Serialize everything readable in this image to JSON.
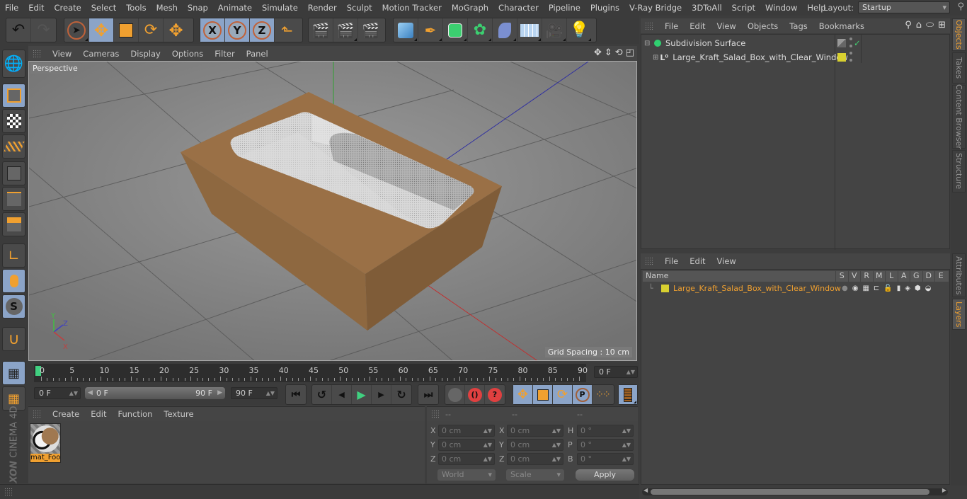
{
  "menubar": {
    "items": [
      "File",
      "Edit",
      "Create",
      "Select",
      "Tools",
      "Mesh",
      "Snap",
      "Animate",
      "Simulate",
      "Render",
      "Sculpt",
      "Motion Tracker",
      "MoGraph",
      "Character",
      "Pipeline",
      "Plugins",
      "V-Ray Bridge",
      "3DToAll",
      "Script",
      "Window",
      "Help"
    ],
    "layout_label": "Layout:",
    "layout_value": "Startup"
  },
  "toolbar": {
    "undo": "undo-icon",
    "redo": "redo-icon",
    "axis_x": "X",
    "axis_y": "Y",
    "axis_z": "Z"
  },
  "viewport": {
    "menu": [
      "View",
      "Cameras",
      "Display",
      "Options",
      "Filter",
      "Panel"
    ],
    "camera_label": "Perspective",
    "grid_spacing": "Grid Spacing : 10 cm",
    "axis_labels": {
      "x": "X",
      "y": "Y",
      "z": "Z"
    }
  },
  "timeline": {
    "ticks": [
      "0",
      "5",
      "10",
      "15",
      "20",
      "25",
      "30",
      "35",
      "40",
      "45",
      "50",
      "55",
      "60",
      "65",
      "70",
      "75",
      "80",
      "85",
      "90"
    ],
    "current_frame": "0 F",
    "start_field": "0 F",
    "range_start": "0 F",
    "range_end": "90 F",
    "end_field": "90 F"
  },
  "materials": {
    "menu": [
      "Create",
      "Edit",
      "Function",
      "Texture"
    ],
    "items": [
      {
        "name": "mat_Foo"
      }
    ]
  },
  "branding": {
    "maxon": "MAXON",
    "product": "CINEMA 4D"
  },
  "coordinates": {
    "headers": [
      "--",
      "--",
      "--"
    ],
    "rows": [
      {
        "l1": "X",
        "v1": "0 cm",
        "l2": "X",
        "v2": "0 cm",
        "l3": "H",
        "v3": "0 °"
      },
      {
        "l1": "Y",
        "v1": "0 cm",
        "l2": "Y",
        "v2": "0 cm",
        "l3": "P",
        "v3": "0 °"
      },
      {
        "l1": "Z",
        "v1": "0 cm",
        "l2": "Z",
        "v2": "0 cm",
        "l3": "B",
        "v3": "0 °"
      }
    ],
    "mode_dropdown": "World",
    "type_dropdown": "Scale",
    "apply_label": "Apply"
  },
  "objects_panel": {
    "menu": [
      "File",
      "Edit",
      "View",
      "Objects",
      "Tags",
      "Bookmarks"
    ],
    "items": [
      {
        "name": "Subdivision Surface",
        "checked": "✓"
      },
      {
        "name": "Large_Kraft_Salad_Box_with_Clear_Window",
        "color": "#d8d030"
      }
    ]
  },
  "layers_panel": {
    "menu": [
      "File",
      "Edit",
      "View"
    ],
    "columns": [
      "Name",
      "S",
      "V",
      "R",
      "M",
      "L",
      "A",
      "G",
      "D",
      "E"
    ],
    "items": [
      {
        "name": "Large_Kraft_Salad_Box_with_Clear_Window",
        "color": "#d8d030",
        "text_color": "#f0a030"
      }
    ]
  },
  "right_tabs": {
    "top": [
      "Objects",
      "Takes",
      "Content Browser",
      "Structure"
    ],
    "bottom": [
      "Attributes",
      "Layers"
    ]
  },
  "colors": {
    "accent": "#f0a030",
    "active_button": "#8ba4c8",
    "play_green": "#40d080"
  }
}
